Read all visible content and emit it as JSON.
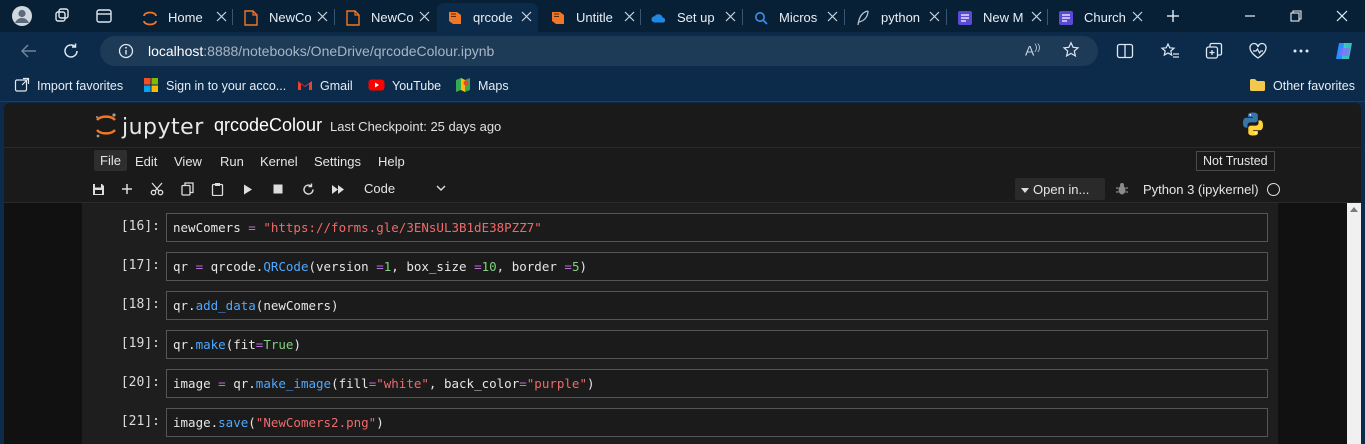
{
  "browser": {
    "tabs": [
      {
        "label": "Home",
        "icon": "jupyter-icon",
        "active": false
      },
      {
        "label": "NewCo",
        "icon": "document-icon",
        "active": false
      },
      {
        "label": "NewCo",
        "icon": "document-icon",
        "active": false
      },
      {
        "label": "qrcode",
        "icon": "book-icon",
        "active": true
      },
      {
        "label": "Untitle",
        "icon": "book-icon",
        "active": false
      },
      {
        "label": "Set up",
        "icon": "onedrive-icon",
        "active": false
      },
      {
        "label": "Micros",
        "icon": "search-icon",
        "active": false
      },
      {
        "label": "python",
        "icon": "feather-icon",
        "active": false
      },
      {
        "label": "New M",
        "icon": "forms-icon",
        "active": false
      },
      {
        "label": "Church",
        "icon": "forms-icon",
        "active": false
      }
    ],
    "address": {
      "host": "localhost",
      "path": ":8888/notebooks/OneDrive/qrcodeColour.ipynb"
    },
    "favorites": [
      {
        "label": "Import favorites",
        "icon": "import-icon"
      },
      {
        "label": "Sign in to your acco...",
        "icon": "microsoft-icon"
      },
      {
        "label": "Gmail",
        "icon": "gmail-icon"
      },
      {
        "label": "YouTube",
        "icon": "youtube-icon"
      },
      {
        "label": "Maps",
        "icon": "maps-icon"
      }
    ],
    "other_favorites": "Other favorites"
  },
  "jupyter": {
    "logo_text": "jupyter",
    "notebook_name": "qrcodeColour",
    "checkpoint": "Last Checkpoint: 25 days ago",
    "menu": [
      "File",
      "Edit",
      "View",
      "Run",
      "Kernel",
      "Settings",
      "Help"
    ],
    "trust_status": "Not Trusted",
    "cell_type": "Code",
    "open_in": "Open in...",
    "kernel_name": "Python 3 (ipykernel)"
  },
  "cells": [
    {
      "prompt": "[16]:",
      "parts": [
        {
          "t": "newComers "
        },
        {
          "t": "=",
          "c": "tk-op"
        },
        {
          "t": " "
        },
        {
          "t": "\"https://forms.gle/3ENsUL3B1dE38PZZ7\"",
          "c": "tk-str"
        }
      ]
    },
    {
      "prompt": "[17]:",
      "parts": [
        {
          "t": "qr "
        },
        {
          "t": "=",
          "c": "tk-op"
        },
        {
          "t": " qrcode."
        },
        {
          "t": "QRCode",
          "c": "tk-fn"
        },
        {
          "t": "(version "
        },
        {
          "t": "=",
          "c": "tk-op"
        },
        {
          "t": "1",
          "c": "tk-num"
        },
        {
          "t": ", box_size "
        },
        {
          "t": "=",
          "c": "tk-op"
        },
        {
          "t": "10",
          "c": "tk-num"
        },
        {
          "t": ", border "
        },
        {
          "t": "=",
          "c": "tk-op"
        },
        {
          "t": "5",
          "c": "tk-num"
        },
        {
          "t": ")"
        }
      ]
    },
    {
      "prompt": "[18]:",
      "parts": [
        {
          "t": "qr."
        },
        {
          "t": "add_data",
          "c": "tk-fn"
        },
        {
          "t": "(newComers)"
        }
      ]
    },
    {
      "prompt": "[19]:",
      "parts": [
        {
          "t": "qr."
        },
        {
          "t": "make",
          "c": "tk-fn"
        },
        {
          "t": "(fit"
        },
        {
          "t": "=",
          "c": "tk-op"
        },
        {
          "t": "True",
          "c": "tk-kw"
        },
        {
          "t": ")"
        }
      ]
    },
    {
      "prompt": "[20]:",
      "parts": [
        {
          "t": "image "
        },
        {
          "t": "=",
          "c": "tk-op"
        },
        {
          "t": " qr."
        },
        {
          "t": "make_image",
          "c": "tk-fn"
        },
        {
          "t": "(fill"
        },
        {
          "t": "=",
          "c": "tk-op"
        },
        {
          "t": "\"white\"",
          "c": "tk-str"
        },
        {
          "t": ", back_color"
        },
        {
          "t": "=",
          "c": "tk-op"
        },
        {
          "t": "\"purple\"",
          "c": "tk-str"
        },
        {
          "t": ")"
        }
      ]
    },
    {
      "prompt": "[21]:",
      "parts": [
        {
          "t": "image."
        },
        {
          "t": "save",
          "c": "tk-fn"
        },
        {
          "t": "("
        },
        {
          "t": "\"NewComers2.png\"",
          "c": "tk-str"
        },
        {
          "t": ")"
        }
      ]
    }
  ],
  "colors": {
    "browser_frame": "#072035",
    "browser_toolbar": "#0c2b4a",
    "notebook_bg": "#1e1e1e",
    "string": "#f06a6a",
    "function": "#4ea8ff",
    "operator": "#b86fd6",
    "number": "#7fd37f"
  }
}
